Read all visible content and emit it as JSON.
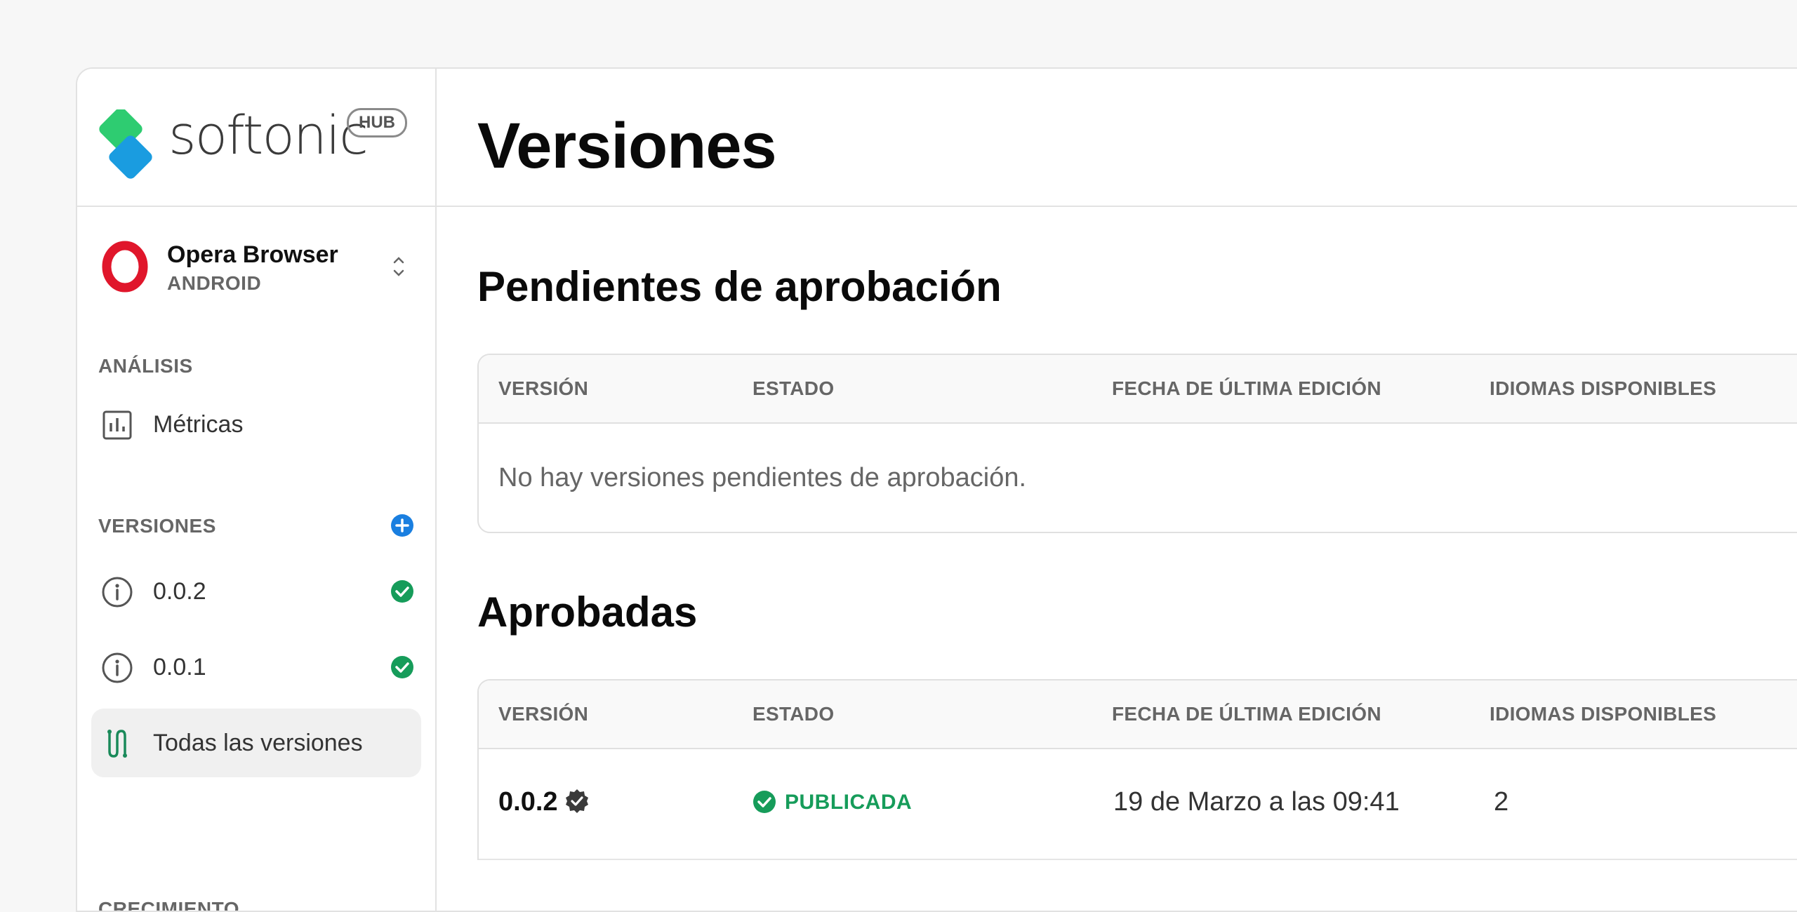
{
  "brand": {
    "name": "softonic",
    "badge": "HUB",
    "colors": {
      "green": "#2ecc71",
      "blue": "#1a9ce0"
    }
  },
  "app_selector": {
    "name": "Opera Browser",
    "platform": "ANDROID",
    "icon": "opera-logo"
  },
  "sidebar": {
    "analysis_label": "ANÁLISIS",
    "metrics_label": "Métricas",
    "versions_label": "VERSIONES",
    "versions": [
      {
        "label": "0.0.2",
        "status": "approved"
      },
      {
        "label": "0.0.1",
        "status": "approved"
      }
    ],
    "all_versions_label": "Todas las versiones",
    "growth_label": "CRECIMIENTO"
  },
  "page": {
    "title": "Versiones",
    "pending": {
      "title": "Pendientes de aprobación",
      "columns": [
        "VERSIÓN",
        "ESTADO",
        "FECHA DE ÚLTIMA EDICIÓN",
        "IDIOMAS DISPONIBLES"
      ],
      "empty_message": "No hay versiones pendientes de aprobación."
    },
    "approved": {
      "title": "Aprobadas",
      "columns": [
        "VERSIÓN",
        "ESTADO",
        "FECHA DE ÚLTIMA EDICIÓN",
        "IDIOMAS DISPONIBLES"
      ],
      "rows": [
        {
          "version": "0.0.2",
          "status": "PUBLICADA",
          "date": "19 de Marzo a las 09:41",
          "languages": "2"
        }
      ]
    }
  },
  "colors": {
    "accent_blue": "#1a7fe0",
    "success_green": "#169c5a"
  }
}
